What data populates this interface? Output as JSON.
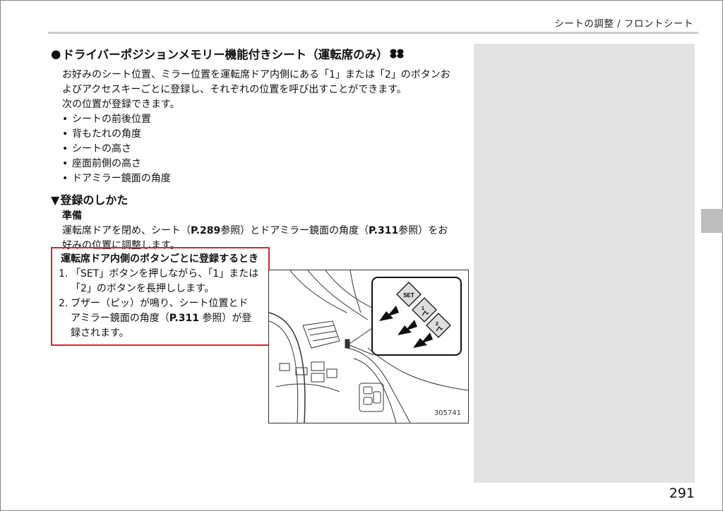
{
  "header": {
    "text": "シートの調整 / フロントシート"
  },
  "page_number": "291",
  "section": {
    "bullet": "●",
    "title": "ドライバーポジションメモリー機能付きシート（運転席のみ）",
    "title_icon": "option-icon",
    "intro_lines": [
      "お好みのシート位置、ミラー位置を運転席ドア内側にある「1」または「2」のボタンお",
      "よびアクセスキーごとに登録し、それぞれの位置を呼び出すことができます。",
      "次の位置が登録できます。"
    ],
    "items": [
      "シートの前後位置",
      "背もたれの角度",
      "シートの高さ",
      "座面前側の高さ",
      "ドアミラー鏡面の角度"
    ],
    "item_bullet": "•"
  },
  "registration": {
    "marker": "▼",
    "title": "登録のしかた",
    "prep_label": "準備",
    "prep_line1_a": "運転席ドアを閉め、シート（",
    "prep_ref1": "P.289",
    "prep_line1_b": "参照）とドアミラー鏡面の角度（",
    "prep_ref2": "P.311",
    "prep_line1_c": "参照）をお",
    "prep_line2": "好みの位置に調整します。"
  },
  "door_buttons": {
    "title": "運転席ドア内側のボタンごとに登録するとき",
    "steps": [
      {
        "num": "1.",
        "lines": [
          "「SET」ボタンを押しながら、「1」または",
          "「2」のボタンを長押しします。"
        ]
      },
      {
        "num": "2.",
        "line1": "ブザー（ピッ）が鳴り、シート位置とド",
        "line2_a": "アミラー鏡面の角度（",
        "line2_ref": "P.311",
        "line2_b": " 参照）が登",
        "line3": "録されます。"
      }
    ]
  },
  "illustration": {
    "code": "305741",
    "set_label": "SET",
    "btn1_label": "1",
    "btn2_label": "2"
  }
}
